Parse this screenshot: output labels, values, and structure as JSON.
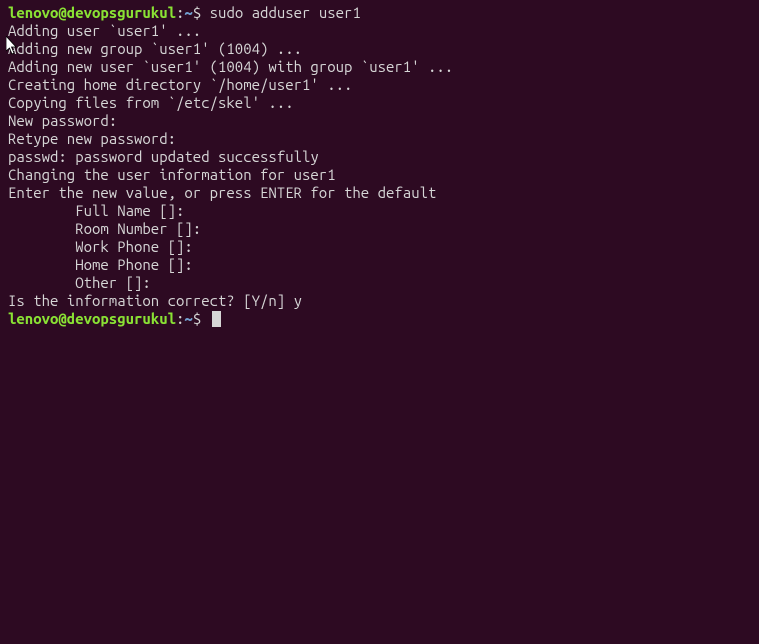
{
  "prompt1": {
    "userhost": "lenovo@devopsgurukul",
    "colon": ":",
    "path": "~",
    "symbol": "$ ",
    "command": "sudo adduser user1"
  },
  "output": [
    "Adding user `user1' ...",
    "Adding new group `user1' (1004) ...",
    "Adding new user `user1' (1004) with group `user1' ...",
    "Creating home directory `/home/user1' ...",
    "Copying files from `/etc/skel' ...",
    "New password:",
    "Retype new password:",
    "passwd: password updated successfully",
    "Changing the user information for user1",
    "Enter the new value, or press ENTER for the default",
    "        Full Name []:",
    "        Room Number []:",
    "        Work Phone []:",
    "        Home Phone []:",
    "        Other []:",
    "Is the information correct? [Y/n] y"
  ],
  "prompt2": {
    "userhost": "lenovo@devopsgurukul",
    "colon": ":",
    "path": "~",
    "symbol": "$ "
  }
}
